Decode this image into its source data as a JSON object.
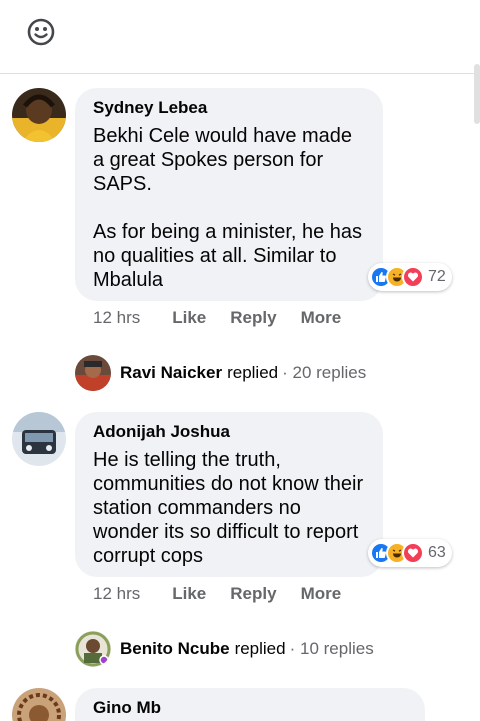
{
  "colors": {
    "bubble": "#f0f2f5",
    "muted": "#65676b",
    "like": "#1877f2",
    "haha": "#f7b125",
    "love": "#f33e58"
  },
  "comments": [
    {
      "author": "Sydney Lebea",
      "text": "Bekhi Cele would have made a great Spokes person for SAPS.\n\nAs for being a minister, he has no qualities at all. Similar to Mbalula",
      "reaction_count": "72",
      "time": "12 hrs",
      "like_label": "Like",
      "reply_label": "Reply",
      "more_label": "More",
      "reply_thread": {
        "name": "Ravi Naicker",
        "verb": "replied",
        "count": "· 20 replies"
      }
    },
    {
      "author": "Adonijah Joshua",
      "text": "He is telling the truth, communities do not know their station commanders no wonder its so difficult to report corrupt cops",
      "reaction_count": "63",
      "time": "12 hrs",
      "like_label": "Like",
      "reply_label": "Reply",
      "more_label": "More",
      "reply_thread": {
        "name": "Benito Ncube",
        "verb": "replied",
        "count": "· 10 replies"
      }
    },
    {
      "author": "Gino Mb"
    }
  ]
}
